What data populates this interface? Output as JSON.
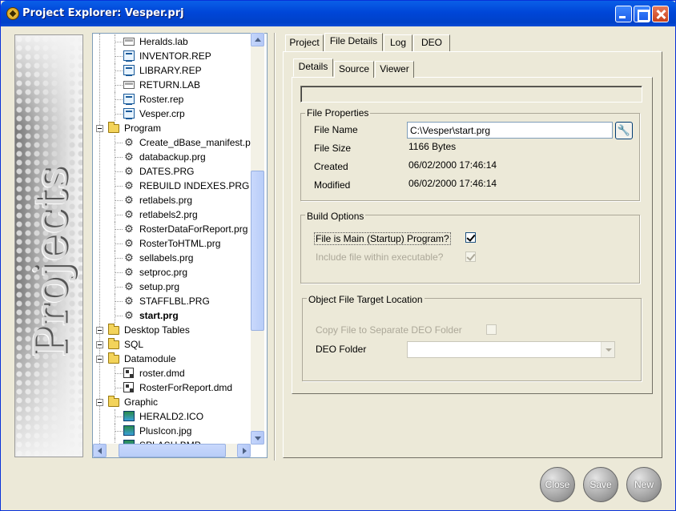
{
  "window": {
    "title": "Project Explorer: Vesper.prj"
  },
  "banner": {
    "text": "Projects"
  },
  "tree": {
    "items": [
      {
        "label": "Heralds.lab",
        "icon": "lab-file-icon",
        "level": 2
      },
      {
        "label": "INVENTOR.REP",
        "icon": "report-file-icon",
        "level": 2
      },
      {
        "label": "LIBRARY.REP",
        "icon": "report-file-icon",
        "level": 2
      },
      {
        "label": "RETURN.LAB",
        "icon": "lab-file-icon",
        "level": 2
      },
      {
        "label": "Roster.rep",
        "icon": "report-file-icon",
        "level": 2
      },
      {
        "label": "Vesper.crp",
        "icon": "report-file-icon",
        "level": 2
      },
      {
        "label": "Program",
        "icon": "folder-icon",
        "level": 1
      },
      {
        "label": "Create_dBase_manifest.p",
        "icon": "program-file-icon",
        "level": 2
      },
      {
        "label": "databackup.prg",
        "icon": "program-file-icon",
        "level": 2
      },
      {
        "label": "DATES.PRG",
        "icon": "program-file-icon",
        "level": 2
      },
      {
        "label": "REBUILD INDEXES.PRG",
        "icon": "program-file-icon",
        "level": 2
      },
      {
        "label": "retlabels.prg",
        "icon": "program-file-icon",
        "level": 2
      },
      {
        "label": "retlabels2.prg",
        "icon": "program-file-icon",
        "level": 2
      },
      {
        "label": "RosterDataForReport.prg",
        "icon": "program-file-icon",
        "level": 2
      },
      {
        "label": "RosterToHTML.prg",
        "icon": "program-file-icon",
        "level": 2
      },
      {
        "label": "sellabels.prg",
        "icon": "program-file-icon",
        "level": 2
      },
      {
        "label": "setproc.prg",
        "icon": "program-file-icon",
        "level": 2
      },
      {
        "label": "setup.prg",
        "icon": "program-file-icon",
        "level": 2
      },
      {
        "label": "STAFFLBL.PRG",
        "icon": "program-file-icon",
        "level": 2
      },
      {
        "label": "start.prg",
        "icon": "program-file-icon",
        "level": 2,
        "selected": true
      },
      {
        "label": "Desktop Tables",
        "icon": "folder-icon",
        "level": 1
      },
      {
        "label": "SQL",
        "icon": "folder-icon",
        "level": 1
      },
      {
        "label": "Datamodule",
        "icon": "folder-icon",
        "level": 1
      },
      {
        "label": "roster.dmd",
        "icon": "datamodule-file-icon",
        "level": 2
      },
      {
        "label": "RosterForReport.dmd",
        "icon": "datamodule-file-icon",
        "level": 2
      },
      {
        "label": "Graphic",
        "icon": "folder-icon",
        "level": 1
      },
      {
        "label": "HERALD2.ICO",
        "icon": "image-file-icon",
        "level": 2
      },
      {
        "label": "PlusIcon.jpg",
        "icon": "image-file-icon",
        "level": 2
      },
      {
        "label": "SPLASH.BMP",
        "icon": "image-file-icon",
        "level": 2
      }
    ]
  },
  "tabs": {
    "outer": [
      "Project",
      "File Details",
      "Log",
      "DEO"
    ],
    "outer_active": "File Details",
    "inner": [
      "Details",
      "Source",
      "Viewer"
    ],
    "inner_active": "Details"
  },
  "file_properties": {
    "title": "File Properties",
    "file_name_label": "File Name",
    "file_name_value": "C:\\Vesper\\start.prg",
    "file_size_label": "File Size",
    "file_size_value": "1166 Bytes",
    "created_label": "Created",
    "created_value": "06/02/2000 17:46:14",
    "modified_label": "Modified",
    "modified_value": "06/02/2000 17:46:14"
  },
  "build_options": {
    "title": "Build Options",
    "main_program_label": "File is Main (Startup) Program?",
    "main_program_checked": true,
    "include_label": "Include file within executable?",
    "include_checked": true
  },
  "object_target": {
    "title": "Object File Target Location",
    "copy_label": "Copy File to Separate DEO Folder",
    "copy_checked": false,
    "deo_folder_label": "DEO Folder",
    "deo_folder_value": ""
  },
  "buttons": {
    "close": "Close",
    "save": "Save",
    "new": "New"
  }
}
